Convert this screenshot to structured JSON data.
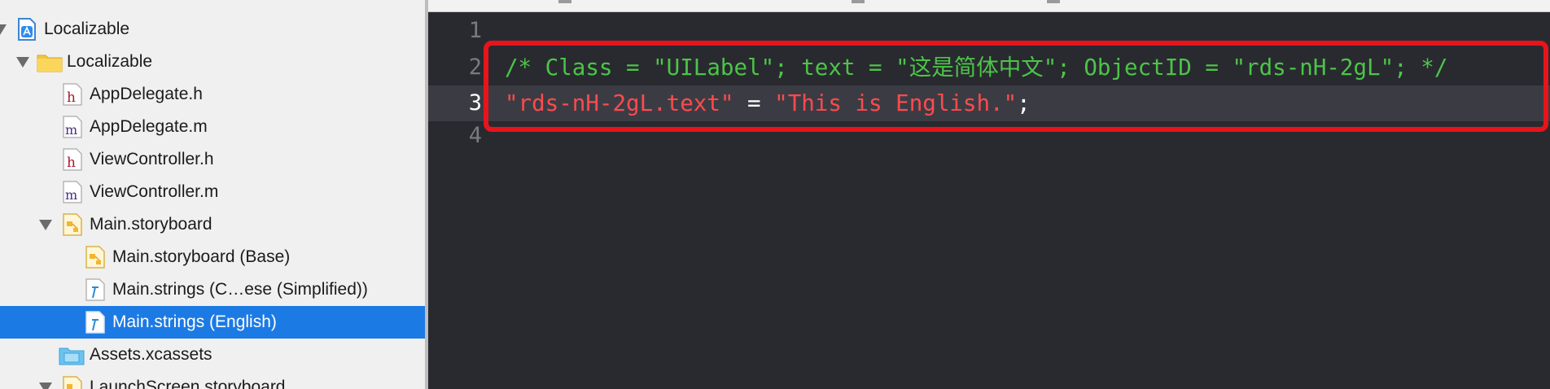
{
  "navigator": {
    "items": [
      {
        "label": "Localizable",
        "icon": "project-icon",
        "disclosure": "expanded"
      },
      {
        "label": "Localizable",
        "icon": "folder-icon",
        "disclosure": "expanded"
      },
      {
        "label": "AppDelegate.h",
        "icon": "header-file-icon"
      },
      {
        "label": "AppDelegate.m",
        "icon": "implementation-file-icon"
      },
      {
        "label": "ViewController.h",
        "icon": "header-file-icon"
      },
      {
        "label": "ViewController.m",
        "icon": "implementation-file-icon"
      },
      {
        "label": "Main.storyboard",
        "icon": "storyboard-icon",
        "disclosure": "expanded"
      },
      {
        "label": "Main.storyboard (Base)",
        "icon": "storyboard-icon"
      },
      {
        "label": "Main.strings (C…ese (Simplified))",
        "icon": "strings-file-icon"
      },
      {
        "label": "Main.strings (English)",
        "icon": "strings-file-icon",
        "selected": true
      },
      {
        "label": "Assets.xcassets",
        "icon": "asset-catalog-icon"
      },
      {
        "label": "LaunchScreen.storyboard",
        "icon": "storyboard-icon",
        "disclosure": "expanded"
      }
    ],
    "header_letter": "h",
    "impl_letter": "m"
  },
  "editor": {
    "current_line": 3,
    "lines": [
      {
        "number": "1",
        "tokens": []
      },
      {
        "number": "2",
        "tokens": [
          {
            "type": "comment",
            "text": "/* Class = \"UILabel\"; text = \"这是简体中文\"; ObjectID = \"rds-nH-2gL\"; */"
          }
        ]
      },
      {
        "number": "3",
        "tokens": [
          {
            "type": "string",
            "text": "\"rds-nH-2gL.text\""
          },
          {
            "type": "op",
            "text": " = "
          },
          {
            "type": "string",
            "text": "\"This is English.\""
          },
          {
            "type": "op",
            "text": ";"
          }
        ]
      },
      {
        "number": "4",
        "tokens": []
      }
    ]
  },
  "colors": {
    "comment": "#4cc448",
    "string": "#ff4a4e",
    "selection": "#1c7ae4",
    "highlight_box": "#e8141b",
    "editor_background": "#292a30"
  }
}
